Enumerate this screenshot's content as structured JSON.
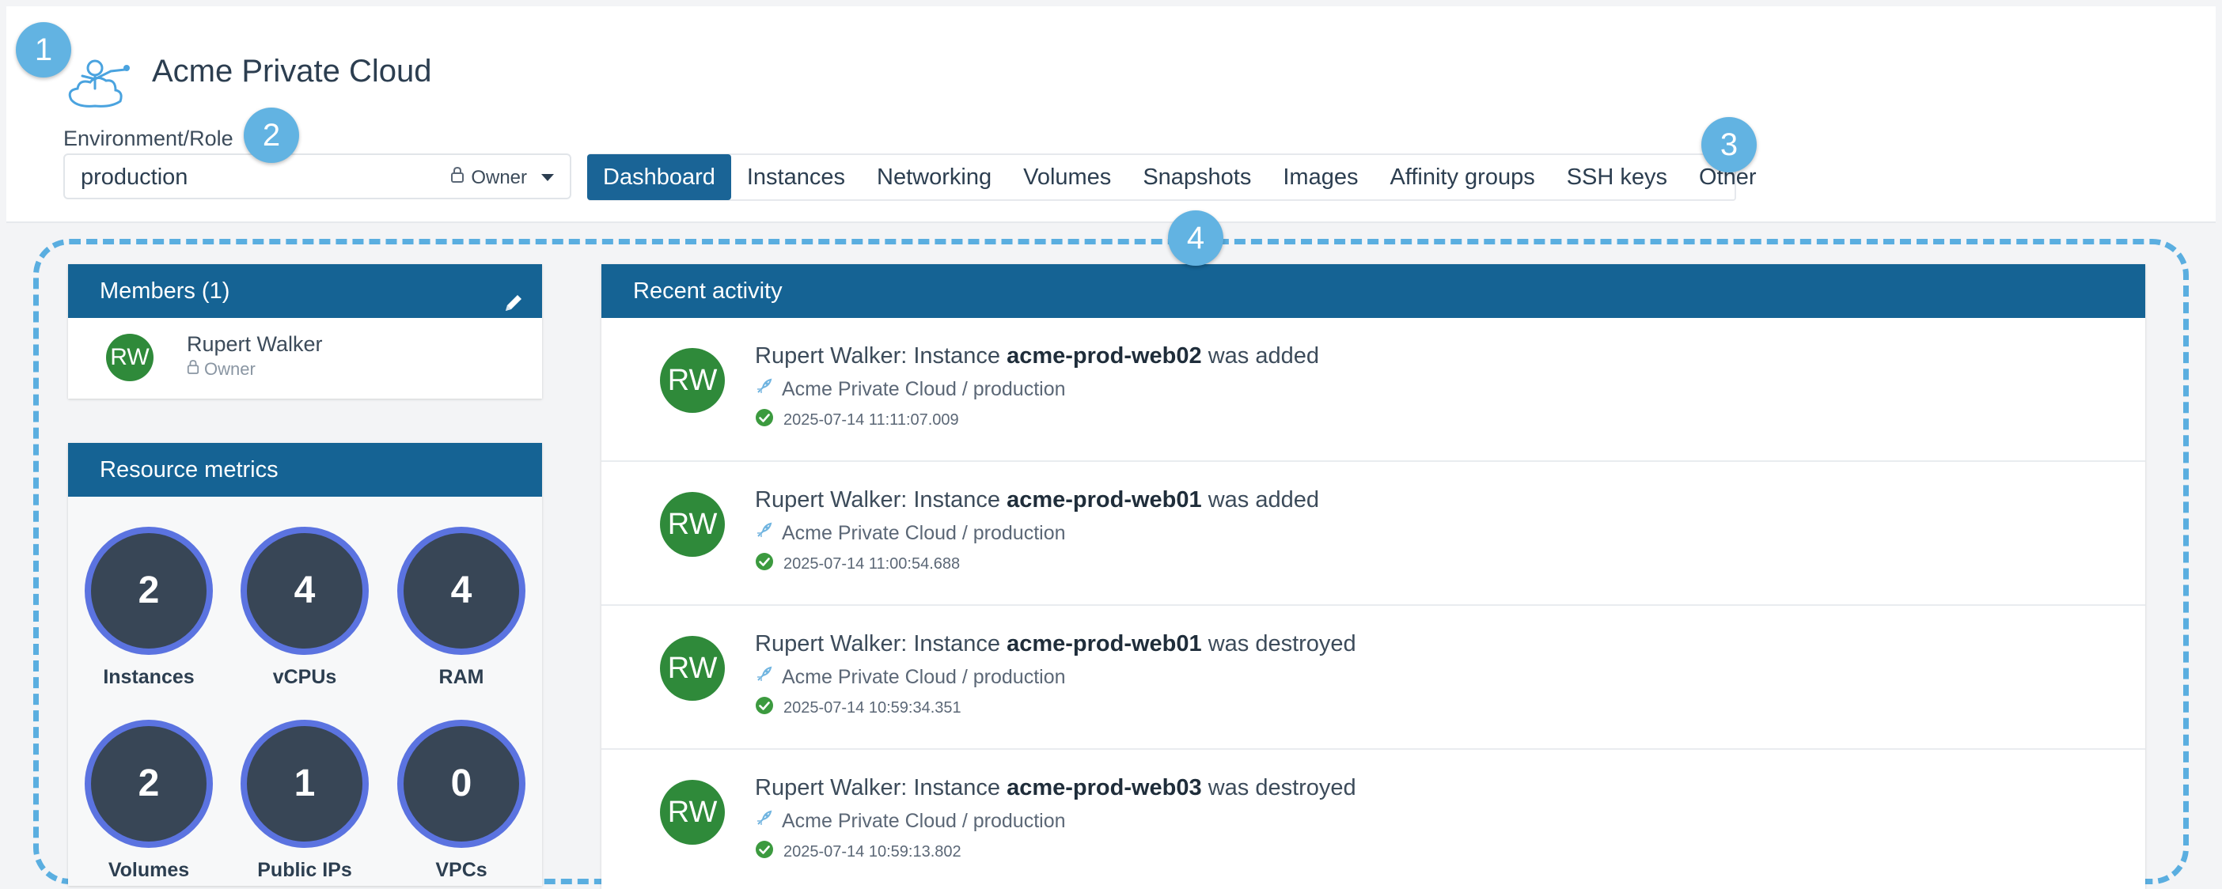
{
  "header": {
    "app_title": "Acme Private Cloud",
    "env_label": "Environment/Role",
    "env_value": "production",
    "role": "Owner"
  },
  "tabs": [
    {
      "label": "Dashboard",
      "active": true
    },
    {
      "label": "Instances"
    },
    {
      "label": "Networking"
    },
    {
      "label": "Volumes"
    },
    {
      "label": "Snapshots"
    },
    {
      "label": "Images"
    },
    {
      "label": "Affinity groups"
    },
    {
      "label": "SSH keys"
    },
    {
      "label": "Other"
    }
  ],
  "callouts": [
    "1",
    "2",
    "3",
    "4"
  ],
  "members": {
    "title": "Members (1)",
    "items": [
      {
        "initials": "RW",
        "name": "Rupert Walker",
        "role": "Owner"
      }
    ]
  },
  "metrics": {
    "title": "Resource metrics",
    "items": [
      {
        "value": "2",
        "label": "Instances"
      },
      {
        "value": "4",
        "label": "vCPUs"
      },
      {
        "value": "4",
        "label": "RAM"
      },
      {
        "value": "2",
        "label": "Volumes"
      },
      {
        "value": "1",
        "label": "Public IPs"
      },
      {
        "value": "0",
        "label": "VPCs"
      }
    ]
  },
  "activity": {
    "title": "Recent activity",
    "items": [
      {
        "initials": "RW",
        "prefix": "Rupert Walker: Instance ",
        "target": "acme-prod-web02",
        "suffix": " was added",
        "context": "Acme Private Cloud / production",
        "time": "2025-07-14 11:11:07.009"
      },
      {
        "initials": "RW",
        "prefix": "Rupert Walker: Instance ",
        "target": "acme-prod-web01",
        "suffix": " was added",
        "context": "Acme Private Cloud / production",
        "time": "2025-07-14 11:00:54.688"
      },
      {
        "initials": "RW",
        "prefix": "Rupert Walker: Instance ",
        "target": "acme-prod-web01",
        "suffix": " was destroyed",
        "context": "Acme Private Cloud / production",
        "time": "2025-07-14 10:59:34.351"
      },
      {
        "initials": "RW",
        "prefix": "Rupert Walker: Instance ",
        "target": "acme-prod-web03",
        "suffix": " was destroyed",
        "context": "Acme Private Cloud / production",
        "time": "2025-07-14 10:59:13.802"
      }
    ]
  },
  "colors": {
    "primary": "#156394",
    "avatar": "#2f8a3a",
    "metric_ring": "#5b73e0",
    "callout": "#62b3e2",
    "success": "#3c9a3f"
  },
  "icons": {
    "logo": "cloud-character-logo",
    "role": "lock-icon",
    "edit": "pencil-icon",
    "context": "rocket-icon",
    "status": "check-circle-icon"
  }
}
